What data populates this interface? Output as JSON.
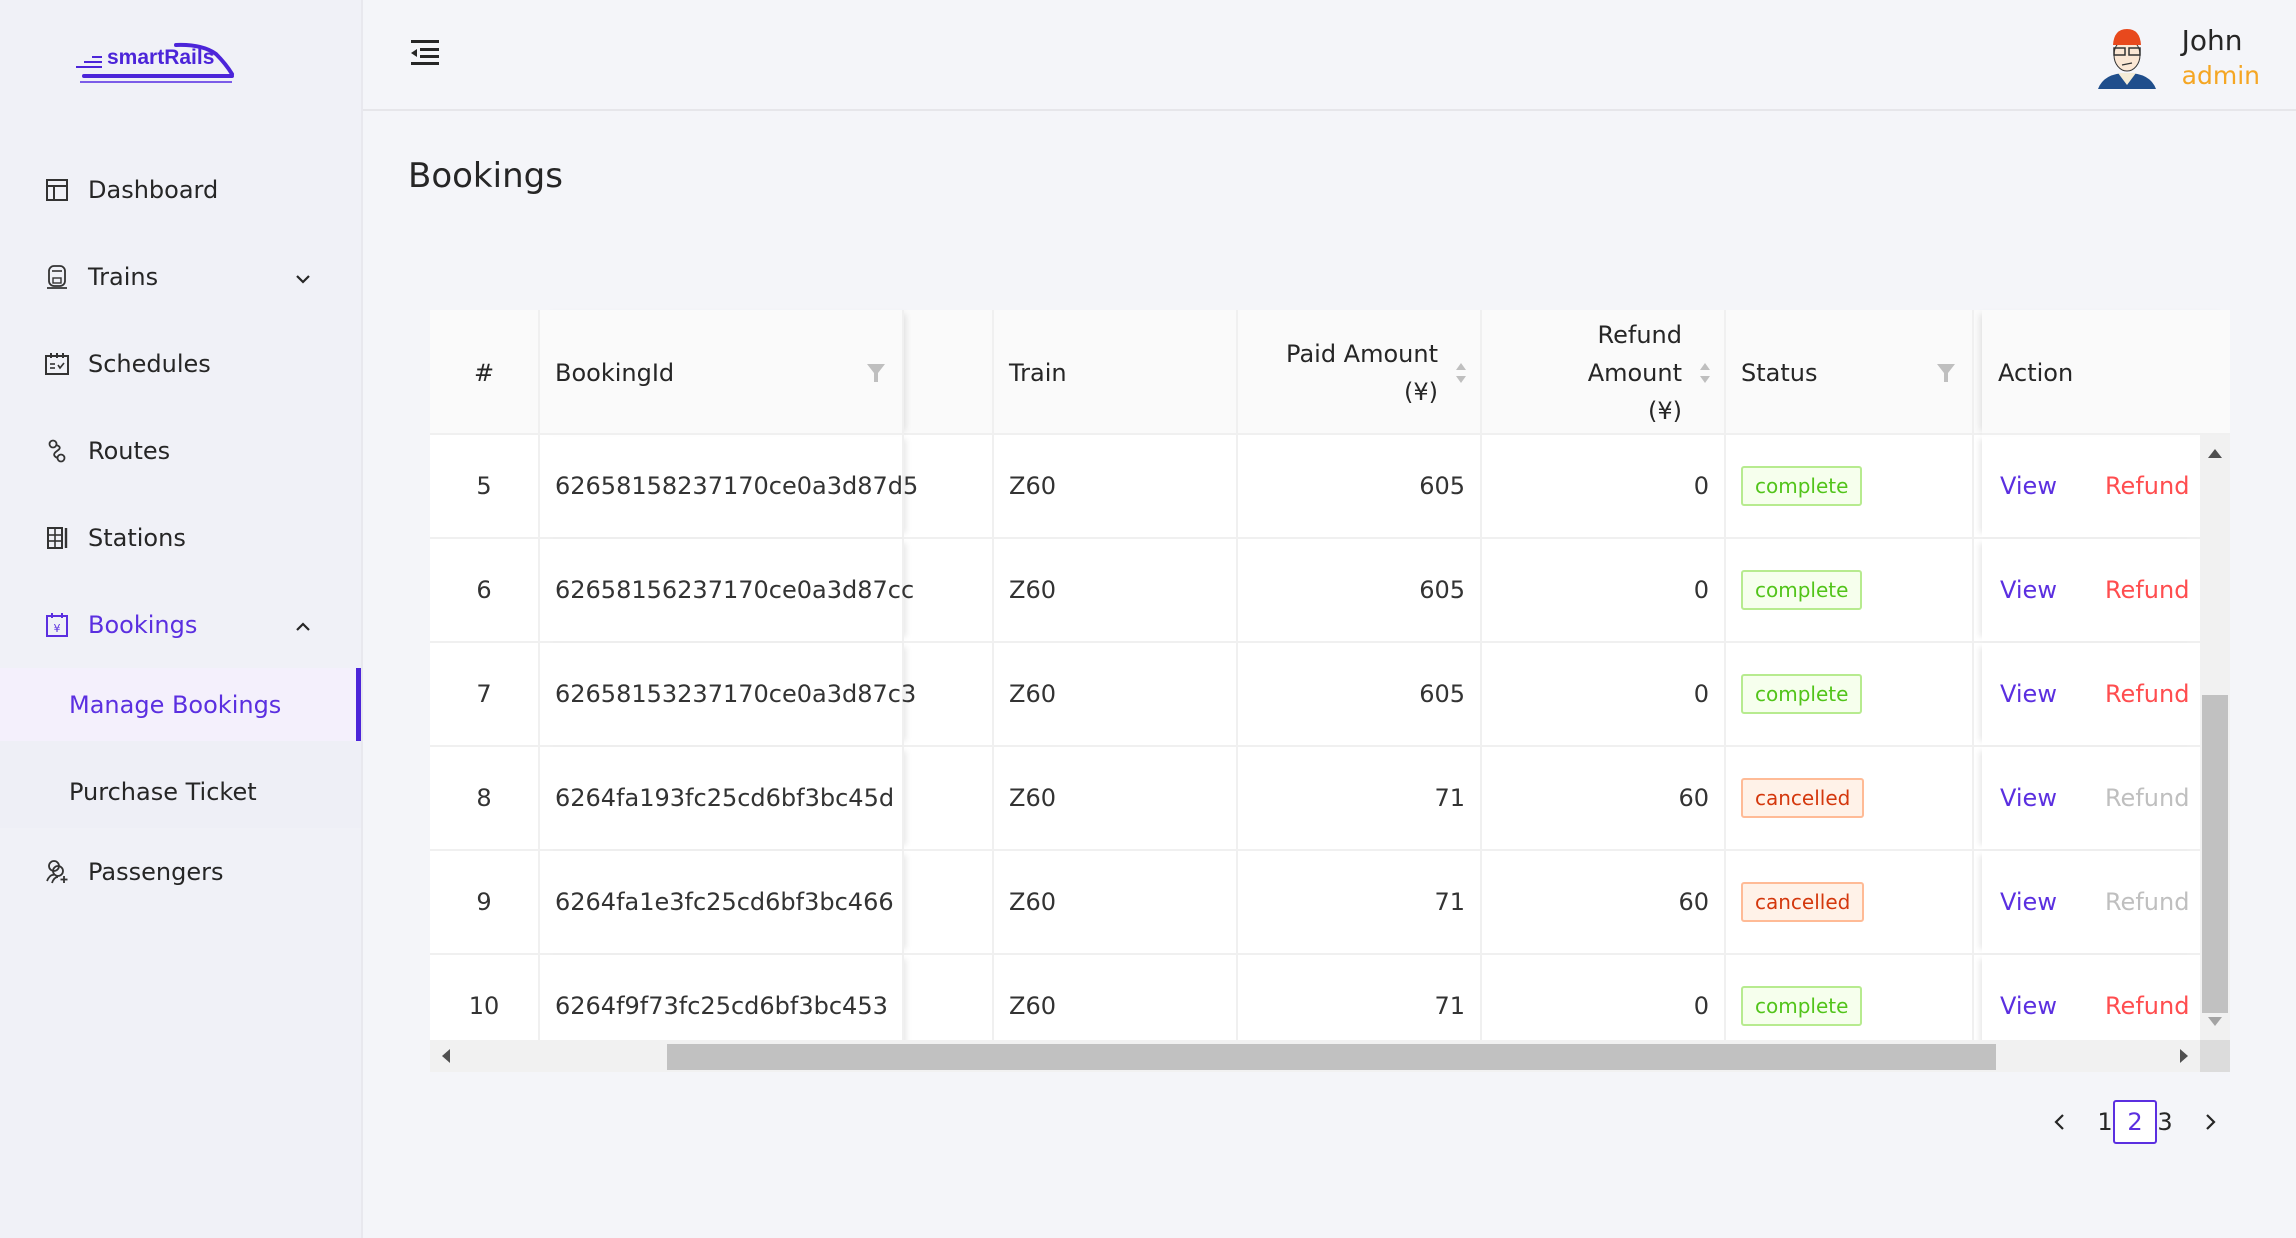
{
  "app": {
    "logo_text": "smartRails",
    "brand_color": "#5b2fe0"
  },
  "sidebar": {
    "items": [
      {
        "label": "Dashboard",
        "icon": "dashboard-icon"
      },
      {
        "label": "Trains",
        "icon": "train-icon",
        "expandable": true,
        "expanded": false
      },
      {
        "label": "Schedules",
        "icon": "calendar-check-icon"
      },
      {
        "label": "Routes",
        "icon": "route-icon"
      },
      {
        "label": "Stations",
        "icon": "building-icon"
      },
      {
        "label": "Bookings",
        "icon": "calendar-yen-icon",
        "expandable": true,
        "expanded": true,
        "children": [
          {
            "label": "Manage Bookings",
            "active": true
          },
          {
            "label": "Purchase Ticket",
            "active": false
          }
        ]
      },
      {
        "label": "Passengers",
        "icon": "user-add-icon"
      }
    ]
  },
  "header": {
    "collapse_icon": "menu-fold-icon",
    "user": {
      "name": "John",
      "role": "admin"
    }
  },
  "page": {
    "title": "Bookings"
  },
  "table": {
    "columns": {
      "index": "#",
      "booking_id": "BookingId",
      "train": "Train",
      "paid_amount_line1": "Paid Amount",
      "paid_amount_line2": "(¥)",
      "refund_amount_line1": "Refund Amount",
      "refund_amount_line2": "(¥)",
      "status": "Status",
      "action": "Action"
    },
    "rows": [
      {
        "index": "5",
        "booking_id": "62658158237170ce0a3d87d5",
        "train": "Z60",
        "paid": "605",
        "refund": "0",
        "status": "complete",
        "view": "View",
        "refund_action": "Refund",
        "refund_enabled": true
      },
      {
        "index": "6",
        "booking_id": "62658156237170ce0a3d87cc",
        "train": "Z60",
        "paid": "605",
        "refund": "0",
        "status": "complete",
        "view": "View",
        "refund_action": "Refund",
        "refund_enabled": true
      },
      {
        "index": "7",
        "booking_id": "62658153237170ce0a3d87c3",
        "train": "Z60",
        "paid": "605",
        "refund": "0",
        "status": "complete",
        "view": "View",
        "refund_action": "Refund",
        "refund_enabled": true
      },
      {
        "index": "8",
        "booking_id": "6264fa193fc25cd6bf3bc45d",
        "train": "Z60",
        "paid": "71",
        "refund": "60",
        "status": "cancelled",
        "view": "View",
        "refund_action": "Refund",
        "refund_enabled": false
      },
      {
        "index": "9",
        "booking_id": "6264fa1e3fc25cd6bf3bc466",
        "train": "Z60",
        "paid": "71",
        "refund": "60",
        "status": "cancelled",
        "view": "View",
        "refund_action": "Refund",
        "refund_enabled": false
      },
      {
        "index": "10",
        "booking_id": "6264f9f73fc25cd6bf3bc453",
        "train": "Z60",
        "paid": "71",
        "refund": "0",
        "status": "complete",
        "view": "View",
        "refund_action": "Refund",
        "refund_enabled": true
      }
    ]
  },
  "pagination": {
    "pages": [
      "1",
      "2",
      "3"
    ],
    "current": "2"
  }
}
